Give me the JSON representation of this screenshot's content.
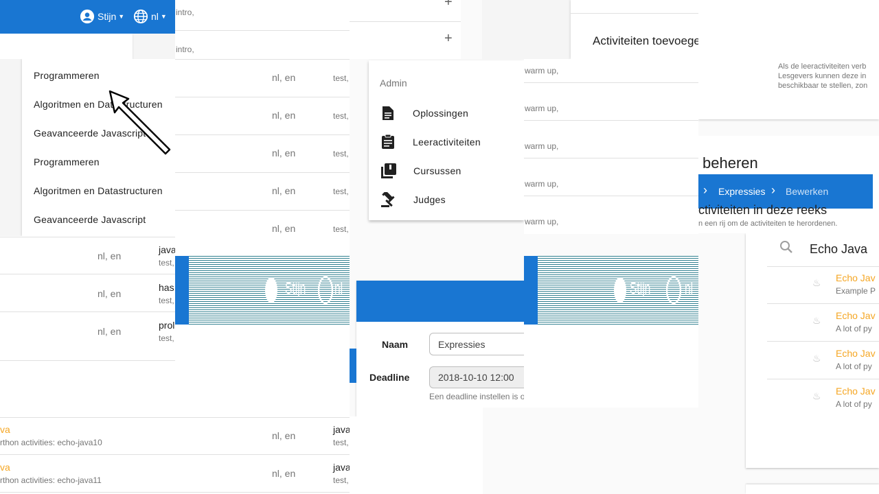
{
  "topbar": {
    "user": "Stijn",
    "language": "nl"
  },
  "dropdown": {
    "items": [
      "Programmeren",
      "Algoritmen en Datastructuren",
      "Geavanceerde Javascript",
      "Programmeren",
      "Algoritmen en Datastructuren",
      "Geavanceerde Javascript"
    ]
  },
  "rows_a": [
    {
      "lang": "nl, en",
      "tags": "test,"
    },
    {
      "lang": "nl, en",
      "tags": "test,"
    },
    {
      "lang": "nl, en",
      "tags": "test,"
    },
    {
      "lang": "nl, en",
      "tags": "test,"
    },
    {
      "lang": "nl, en",
      "tags": "test,"
    }
  ],
  "intro_rows": [
    "intro,",
    "intro,"
  ],
  "rows_left": [
    {
      "lang": "nl, en",
      "tag": "java",
      "sub": "test,"
    },
    {
      "lang": "nl, en",
      "tag": "has",
      "sub": "test,"
    },
    {
      "lang": "nl, en",
      "tag": "prol",
      "sub": "test,"
    }
  ],
  "rows_bottom": [
    {
      "title": "va",
      "desc": "rthon activities: echo-java10",
      "lang": "nl, en",
      "tag": "java",
      "sub": "test,"
    },
    {
      "title": "va",
      "desc": "rthon activities: echo-java11",
      "lang": "nl, en",
      "tag": "java",
      "sub": "test,"
    }
  ],
  "admin_menu": {
    "header": "Admin",
    "items": [
      {
        "label": "Oplossingen",
        "icon": "document-icon"
      },
      {
        "label": "Leeractiviteiten",
        "icon": "clipboard-icon"
      },
      {
        "label": "Cursussen",
        "icon": "library-icon"
      },
      {
        "label": "Judges",
        "icon": "gavel-icon"
      }
    ]
  },
  "warmup_rows": [
    "warm up,",
    "warm up,",
    "warm up,",
    "warm up,",
    "warm up,"
  ],
  "form": {
    "name_label": "Naam",
    "name_value": "Expressies",
    "deadline_label": "Deadline",
    "deadline_value": "2018-10-10 12:00",
    "deadline_hint": "Een deadline instellen is o"
  },
  "ghost_bar": {
    "user": "Stijn",
    "language": "nl"
  },
  "right_top": {
    "add_title": "Activiteiten toevoege",
    "info_lines": [
      "Als de leeractiviteiten verb",
      "Lesgevers kunnen deze in",
      "beschikbaar te stellen, zon"
    ]
  },
  "manage": {
    "title": "beheren",
    "breadcrumb": [
      "Expressies",
      "Bewerken"
    ],
    "subtitle": "ctiviteiten in deze reeks",
    "hint": "n een rij om de activiteiten te herordenen."
  },
  "search": {
    "value": "Echo Java",
    "results": [
      {
        "title": "Echo Jav",
        "desc": "Example P"
      },
      {
        "title": "Echo Jav",
        "desc": "A lot of py"
      },
      {
        "title": "Echo Jav",
        "desc": "A lot of py"
      },
      {
        "title": "Echo Jav",
        "desc": "A lot of py"
      }
    ]
  },
  "colors": {
    "primary": "#1976d2",
    "accent": "#f5a623",
    "stripe": "#2f7f8f"
  }
}
